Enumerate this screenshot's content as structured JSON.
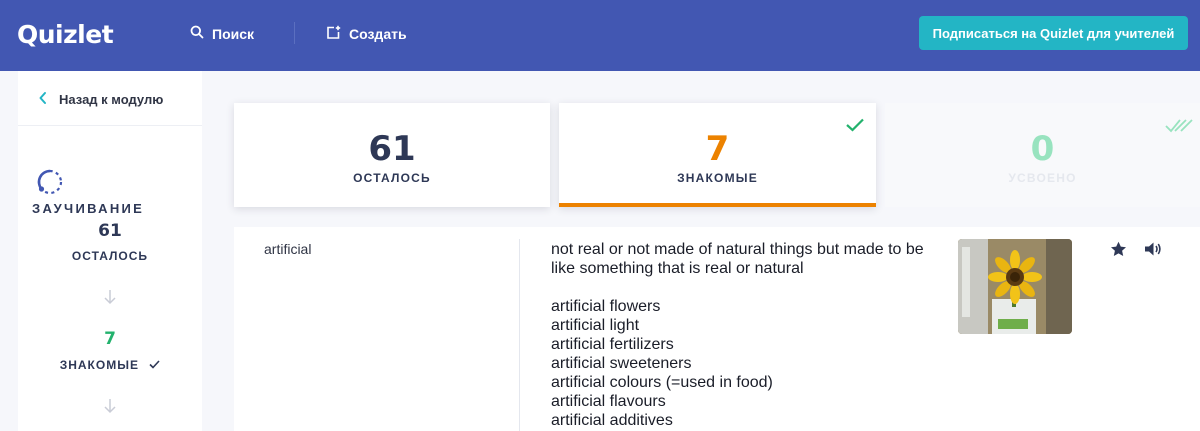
{
  "header": {
    "logo": "Quizlet",
    "search_label": "Поиск",
    "create_label": "Создать",
    "teacher_button": "Подписаться на Quizlet для учителей"
  },
  "sidebar": {
    "back_label": "Назад к модулю",
    "mode_title": "ЗАУЧИВАНИЕ",
    "remaining_count": "61",
    "remaining_label": "ОСТАЛОСЬ",
    "familiar_count": "7",
    "familiar_label": "ЗНАКОМЫЕ"
  },
  "stats": {
    "remaining": {
      "count": "61",
      "label": "ОСТАЛОСЬ"
    },
    "familiar": {
      "count": "7",
      "label": "ЗНАКОМЫЕ"
    },
    "mastered": {
      "count": "0",
      "label": "УСВОЕНО"
    }
  },
  "term": {
    "word": "artificial",
    "definition": "not real or not made of natural things but made to be like something that is real or natural",
    "examples": [
      "artificial flowers",
      "artificial light",
      "artificial fertilizers",
      "artificial sweeteners",
      "artificial colours (=used in food)",
      "artificial flavours",
      "artificial additives"
    ]
  },
  "colors": {
    "header_bg": "#4257b2",
    "teacher_button": "#23b5c5",
    "remaining": "#2e3856",
    "familiar_orange": "#ec8200",
    "familiar_green": "#23b26d",
    "mastered": "#98e3bf"
  },
  "icons": {
    "search": "search-icon",
    "create": "create-set-icon",
    "back": "chevron-left-icon",
    "mode": "learn-mode-icon",
    "arrow": "arrow-down-icon",
    "check": "check-icon",
    "double_check": "double-check-icon",
    "star": "star-icon",
    "audio": "audio-icon"
  }
}
